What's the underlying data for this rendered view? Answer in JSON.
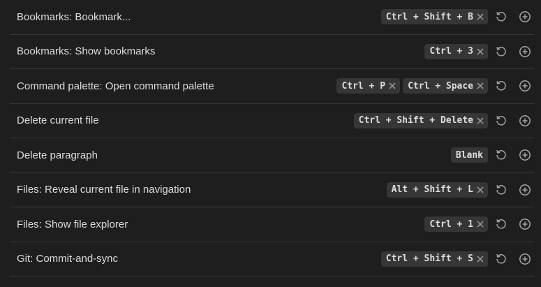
{
  "hotkeys": [
    {
      "name": "Bookmarks: Bookmark...",
      "keys": [
        "Ctrl + Shift + B"
      ],
      "blank": false
    },
    {
      "name": "Bookmarks: Show bookmarks",
      "keys": [
        "Ctrl + 3"
      ],
      "blank": false
    },
    {
      "name": "Command palette: Open command palette",
      "keys": [
        "Ctrl + P",
        "Ctrl + Space"
      ],
      "blank": false
    },
    {
      "name": "Delete current file",
      "keys": [
        "Ctrl + Shift + Delete"
      ],
      "blank": false
    },
    {
      "name": "Delete paragraph",
      "keys": [],
      "blank": true,
      "blank_label": "Blank"
    },
    {
      "name": "Files: Reveal current file in navigation",
      "keys": [
        "Alt + Shift + L"
      ],
      "blank": false
    },
    {
      "name": "Files: Show file explorer",
      "keys": [
        "Ctrl + 1"
      ],
      "blank": false
    },
    {
      "name": "Git: Commit-and-sync",
      "keys": [
        "Ctrl + Shift + S"
      ],
      "blank": false
    }
  ],
  "icons": {
    "remove": "close-icon",
    "restore": "restore-default-icon",
    "add": "add-hotkey-icon"
  },
  "colors": {
    "background": "#1e1e1e",
    "text": "#dcddde",
    "key_bg": "#363636",
    "divider": "#383838",
    "icon": "#a3a3a3"
  }
}
